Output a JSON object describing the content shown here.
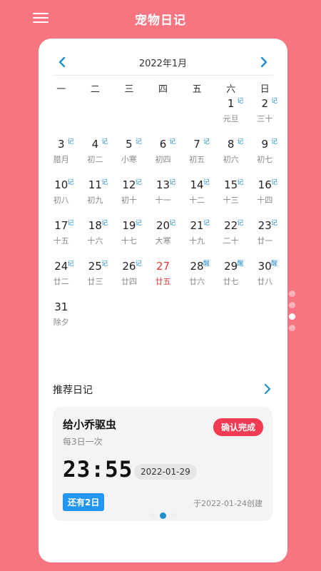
{
  "app": {
    "title": "宠物日记"
  },
  "colors": {
    "background": "#f77581",
    "accent": "#1f8ecf",
    "today": "#e53935",
    "confirm": "#f23a53",
    "badge": "#2196f3"
  },
  "calendar": {
    "month_title": "2022年1月",
    "prev_icon": "chevron-left-icon",
    "next_icon": "chevron-right-icon",
    "weekdays": [
      "一",
      "二",
      "三",
      "四",
      "五",
      "六",
      "日"
    ],
    "leading_blanks": 5,
    "days": [
      {
        "day": "1",
        "lunar": "元旦",
        "tag": "记"
      },
      {
        "day": "2",
        "lunar": "三十",
        "tag": "记"
      },
      {
        "day": "3",
        "lunar": "腊月",
        "tag": "记"
      },
      {
        "day": "4",
        "lunar": "初二",
        "tag": "记"
      },
      {
        "day": "5",
        "lunar": "小寒",
        "tag": "记"
      },
      {
        "day": "6",
        "lunar": "初四",
        "tag": "记"
      },
      {
        "day": "7",
        "lunar": "初五",
        "tag": "记"
      },
      {
        "day": "8",
        "lunar": "初六",
        "tag": "记"
      },
      {
        "day": "9",
        "lunar": "初七",
        "tag": "记"
      },
      {
        "day": "10",
        "lunar": "初八",
        "tag": "记"
      },
      {
        "day": "11",
        "lunar": "初九",
        "tag": "记"
      },
      {
        "day": "12",
        "lunar": "初十",
        "tag": "记"
      },
      {
        "day": "13",
        "lunar": "十一",
        "tag": "记"
      },
      {
        "day": "14",
        "lunar": "十二",
        "tag": "记"
      },
      {
        "day": "15",
        "lunar": "十三",
        "tag": "记"
      },
      {
        "day": "16",
        "lunar": "十四",
        "tag": "记"
      },
      {
        "day": "17",
        "lunar": "十五",
        "tag": "记"
      },
      {
        "day": "18",
        "lunar": "十六",
        "tag": "记"
      },
      {
        "day": "19",
        "lunar": "十七",
        "tag": "记"
      },
      {
        "day": "20",
        "lunar": "大寒",
        "tag": "记"
      },
      {
        "day": "21",
        "lunar": "十九",
        "tag": "记"
      },
      {
        "day": "22",
        "lunar": "二十",
        "tag": "记"
      },
      {
        "day": "23",
        "lunar": "廿一",
        "tag": "记"
      },
      {
        "day": "24",
        "lunar": "廿二",
        "tag": "记"
      },
      {
        "day": "25",
        "lunar": "廿三",
        "tag": "记"
      },
      {
        "day": "26",
        "lunar": "廿四",
        "tag": "记"
      },
      {
        "day": "27",
        "lunar": "廿五",
        "tag": "",
        "today": true
      },
      {
        "day": "28",
        "lunar": "廿六",
        "tag": "醒"
      },
      {
        "day": "29",
        "lunar": "廿七",
        "tag": "醒"
      },
      {
        "day": "30",
        "lunar": "廿八",
        "tag": "醒"
      },
      {
        "day": "31",
        "lunar": "除夕",
        "tag": ""
      }
    ]
  },
  "recommend": {
    "title": "推荐日记",
    "arrow_icon": "chevron-right-icon",
    "item": {
      "title": "给小乔驱虫",
      "frequency": "每3日一次",
      "confirm_label": "确认完成",
      "time": "23:55",
      "date": "2022-01-29",
      "remaining": "还有2日",
      "created": "于2022-01-24创建"
    },
    "carousel_count": 3,
    "carousel_active": 1
  },
  "page_indicator": {
    "count": 4,
    "active": 2
  }
}
